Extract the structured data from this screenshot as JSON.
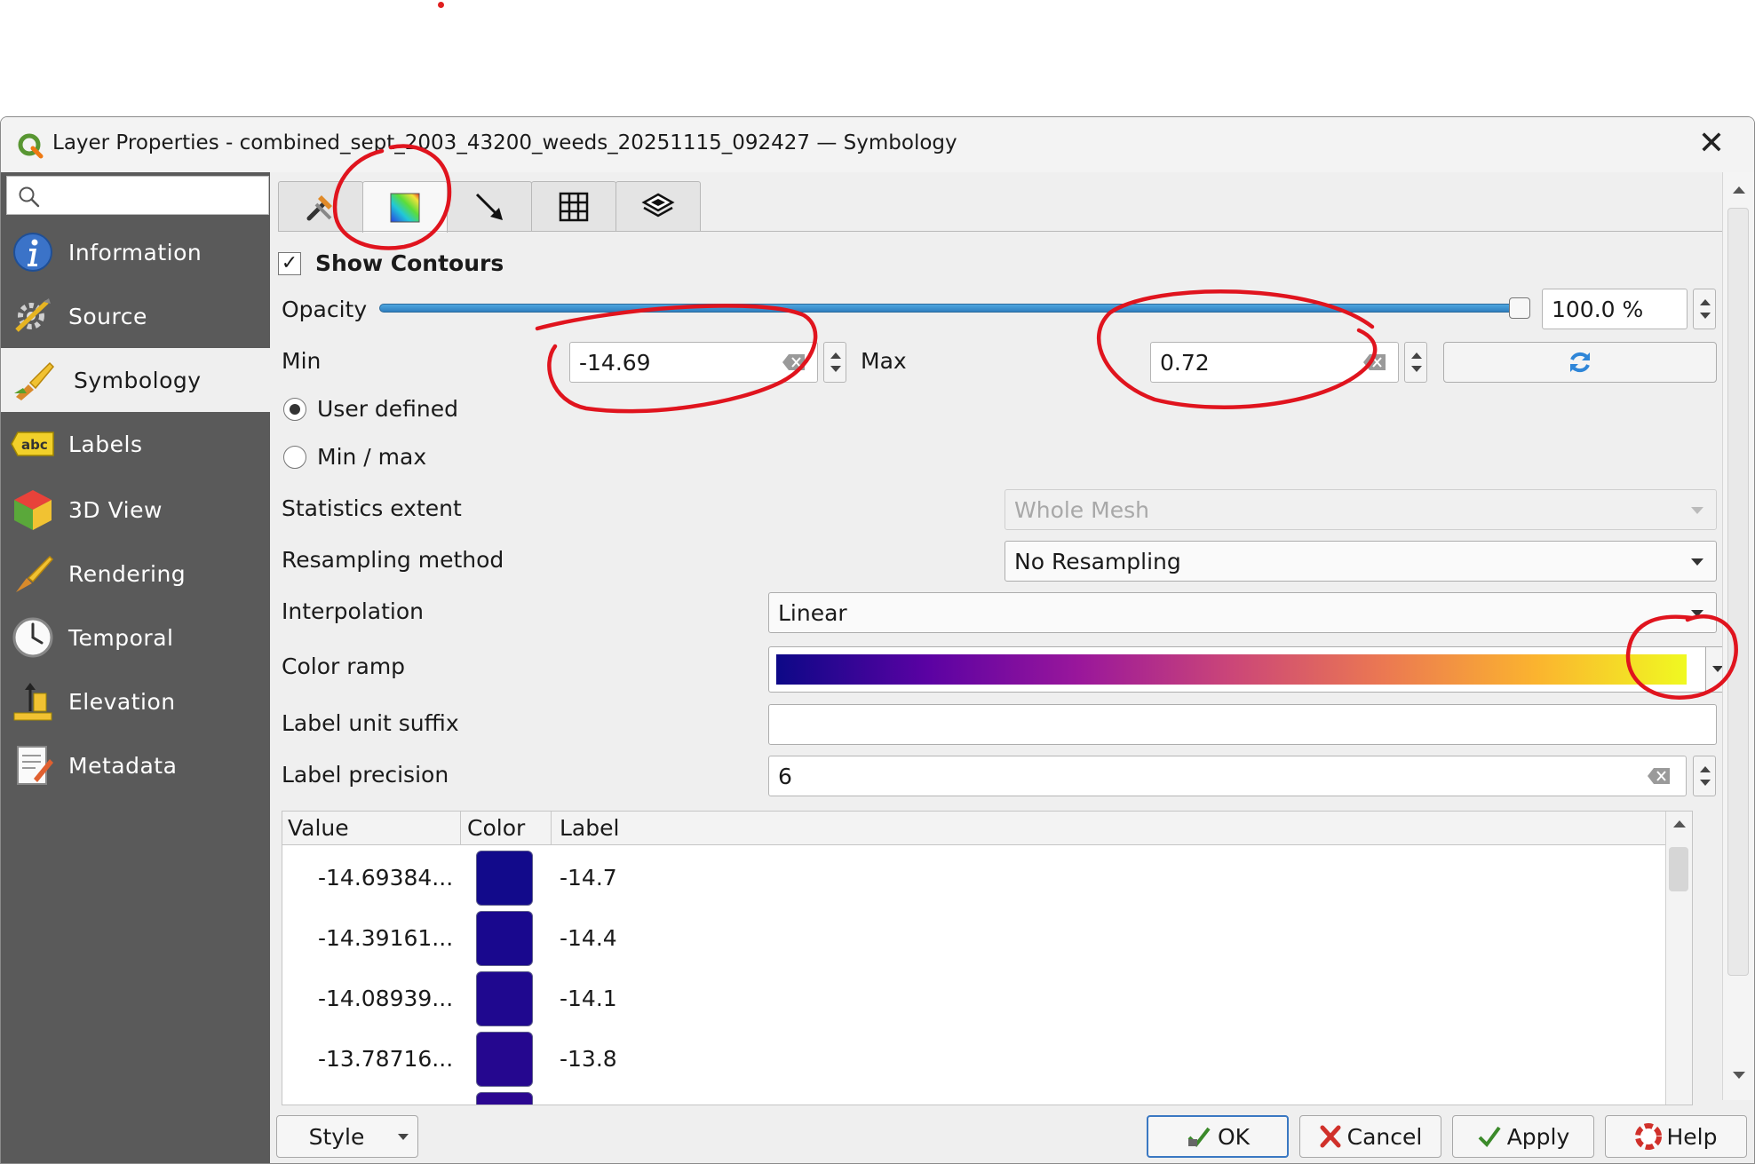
{
  "window": {
    "title": "Layer Properties - combined_sept_2003_43200_weeds_20251115_092427 — Symbology",
    "close_glyph": "✕"
  },
  "sidebar": {
    "search_placeholder": "",
    "items": [
      {
        "label": "Information",
        "icon": "information-icon"
      },
      {
        "label": "Source",
        "icon": "source-icon"
      },
      {
        "label": "Symbology",
        "icon": "symbology-brush-icon",
        "active": true
      },
      {
        "label": "Labels",
        "icon": "labels-abc-icon"
      },
      {
        "label": "3D View",
        "icon": "3d-cube-icon"
      },
      {
        "label": "Rendering",
        "icon": "rendering-brush-icon"
      },
      {
        "label": "Temporal",
        "icon": "clock-icon"
      },
      {
        "label": "Elevation",
        "icon": "elevation-icon"
      },
      {
        "label": "Metadata",
        "icon": "metadata-icon"
      }
    ]
  },
  "tabs": [
    {
      "icon": "datasets-tools-icon"
    },
    {
      "icon": "contours-gradient-icon",
      "active": true
    },
    {
      "icon": "vectors-arrow-icon"
    },
    {
      "icon": "mesh-grid-icon"
    },
    {
      "icon": "layers-stack-icon"
    }
  ],
  "symbology": {
    "show_contours_label": "Show Contours",
    "show_contours_checked": true,
    "opacity_label": "Opacity",
    "opacity_value": "100.0 %",
    "opacity_fraction": 1.0,
    "min_label": "Min",
    "min_value": "-14.69",
    "max_label": "Max",
    "max_value": "0.72",
    "radio_user_defined": "User defined",
    "radio_min_max": "Min / max",
    "selected_mode": "User defined",
    "statistics_extent_label": "Statistics extent",
    "statistics_extent_value": "Whole Mesh",
    "resampling_label": "Resampling method",
    "resampling_value": "No Resampling",
    "interpolation_label": "Interpolation",
    "interpolation_value": "Linear",
    "color_ramp_label": "Color ramp",
    "color_ramp_stops": [
      "#0d0887",
      "#5b02a3",
      "#9a179b",
      "#cb4678",
      "#eb7852",
      "#fbb32f",
      "#f0f921"
    ],
    "label_unit_suffix_label": "Label unit suffix",
    "label_unit_suffix_value": "",
    "label_precision_label": "Label precision",
    "label_precision_value": "6"
  },
  "classes_table": {
    "headers": {
      "value": "Value",
      "color": "Color",
      "label": "Label"
    },
    "rows": [
      {
        "value": "-14.69384...",
        "color": "#120a8b",
        "label": "-14.7"
      },
      {
        "value": "-14.39161...",
        "color": "#19088e",
        "label": "-14.4"
      },
      {
        "value": "-14.08939...",
        "color": "#1f088f",
        "label": "-14.1"
      },
      {
        "value": "-13.78716...",
        "color": "#25078f",
        "label": "-13.8"
      },
      {
        "value": "",
        "color": "#2b0791",
        "label": ""
      }
    ]
  },
  "footer": {
    "style": "Style",
    "ok": "OK",
    "cancel": "Cancel",
    "apply": "Apply",
    "help": "Help"
  },
  "colors": {
    "sidebar_bg": "#5a5a5a",
    "annotation_red": "#e0141e",
    "slider_blue": "#3a8fd0"
  }
}
